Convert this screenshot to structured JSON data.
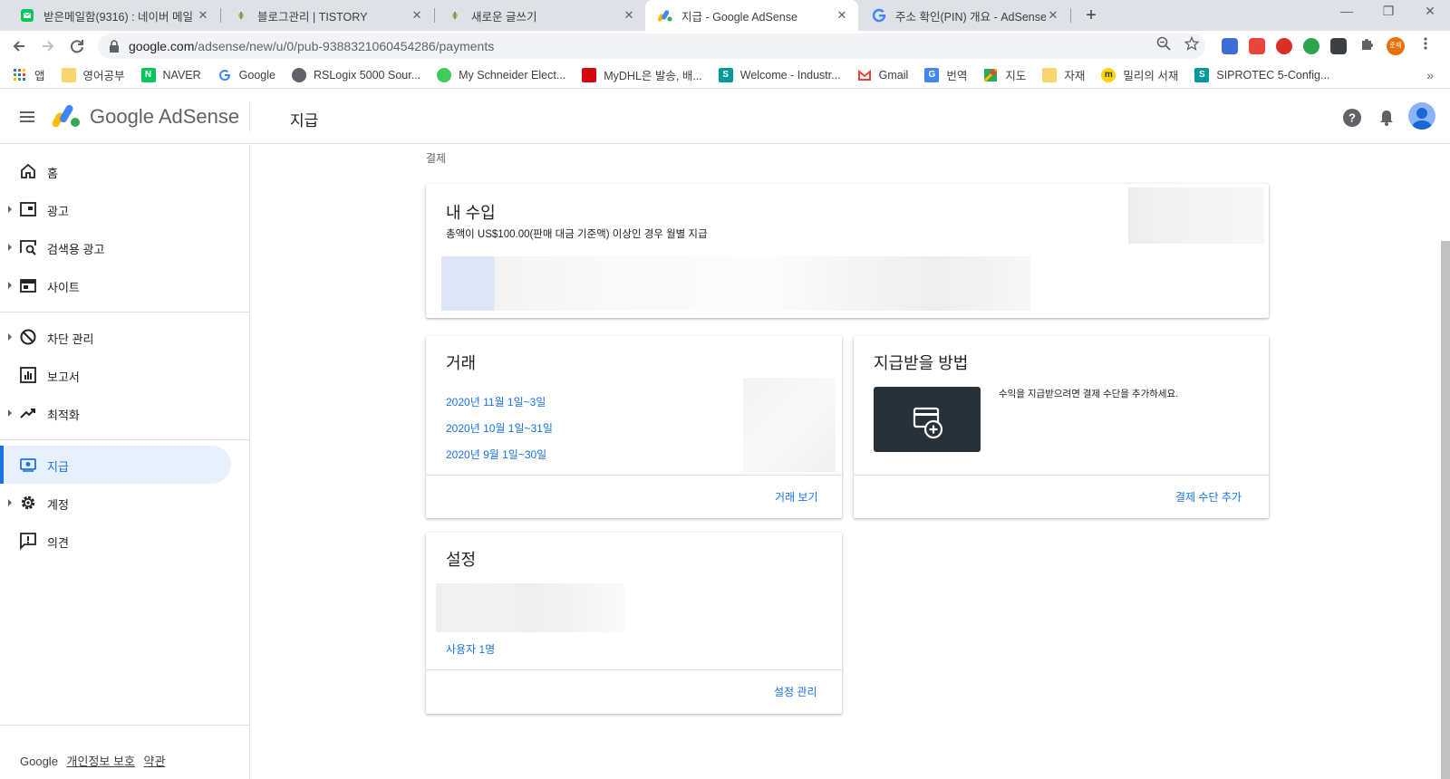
{
  "browser": {
    "tabs": [
      {
        "title": "받은메일함(9316) : 네이버 메일",
        "favicon": "naver-mail-icon"
      },
      {
        "title": "블로그관리 | TISTORY",
        "favicon": "tistory-icon"
      },
      {
        "title": "새로운 글쓰기",
        "favicon": "tistory-icon"
      },
      {
        "title": "지급 - Google AdSense",
        "favicon": "adsense-icon"
      },
      {
        "title": "주소 확인(PIN) 개요 - AdSense",
        "favicon": "google-icon"
      }
    ],
    "close_glyph": "✕",
    "new_tab_glyph": "+",
    "window_controls": [
      "—",
      "❐",
      "✕"
    ],
    "url_host": "google.com",
    "url_path": "/adsense/new/u/0/pub-9388321060454286/payments",
    "profile_initials": "준재",
    "bookmarks": [
      {
        "label": "앱",
        "icon": "apps-grid-icon"
      },
      {
        "label": "영어공부",
        "icon": "folder-icon"
      },
      {
        "label": "NAVER",
        "icon": "naver-icon"
      },
      {
        "label": "Google",
        "icon": "google-icon"
      },
      {
        "label": "RSLogix 5000 Sour...",
        "icon": "globe-icon"
      },
      {
        "label": "My Schneider Elect...",
        "icon": "schneider-icon"
      },
      {
        "label": "MyDHL은 발송, 배...",
        "icon": "dhl-icon"
      },
      {
        "label": "Welcome - Industr...",
        "icon": "siemens-icon"
      },
      {
        "label": "Gmail",
        "icon": "gmail-icon"
      },
      {
        "label": "번역",
        "icon": "translate-icon"
      },
      {
        "label": "지도",
        "icon": "maps-icon"
      },
      {
        "label": "자재",
        "icon": "folder-icon"
      },
      {
        "label": "밀리의 서재",
        "icon": "millie-icon"
      },
      {
        "label": "SIPROTEC 5-Config...",
        "icon": "siemens-icon"
      }
    ],
    "bookmarks_more": "»"
  },
  "header": {
    "logo_text": "Google AdSense",
    "page_title": "지급"
  },
  "sidebar": {
    "items": [
      {
        "label": "홈",
        "icon": "home-icon",
        "expandable": false
      },
      {
        "label": "광고",
        "icon": "ads-icon",
        "expandable": true
      },
      {
        "label": "검색용 광고",
        "icon": "search-ads-icon",
        "expandable": true
      },
      {
        "label": "사이트",
        "icon": "sites-icon",
        "expandable": true
      },
      {
        "label": "차단 관리",
        "icon": "block-icon",
        "expandable": true
      },
      {
        "label": "보고서",
        "icon": "reports-icon",
        "expandable": false
      },
      {
        "label": "최적화",
        "icon": "optimization-icon",
        "expandable": true
      },
      {
        "label": "지급",
        "icon": "payments-icon",
        "expandable": false,
        "active": true
      },
      {
        "label": "계정",
        "icon": "account-gear-icon",
        "expandable": true
      },
      {
        "label": "의견",
        "icon": "feedback-icon",
        "expandable": false
      }
    ],
    "footer": {
      "brand": "Google",
      "privacy": "개인정보 보호",
      "terms": "약관"
    }
  },
  "main": {
    "breadcrumb": "결제",
    "earnings": {
      "title": "내 수입",
      "subtitle": "총액이 US$100.00(판매 대금 기준액) 이상인 경우 월별 지급"
    },
    "transactions": {
      "title": "거래",
      "items": [
        "2020년 11월 1일~3일",
        "2020년 10월 1일~31일",
        "2020년 9월 1일~30일"
      ],
      "action": "거래 보기"
    },
    "payment_method": {
      "title": "지급받을 방법",
      "description": "수익을 지급받으려면 결제 수단을 추가하세요.",
      "action": "결제 수단 추가"
    },
    "settings": {
      "title": "설정",
      "users": "사용자 1명",
      "action": "설정 관리"
    }
  },
  "colors": {
    "accent": "#1a73e8",
    "active_nav_bg": "#e8f0fe",
    "payment_tile": "#263238"
  }
}
